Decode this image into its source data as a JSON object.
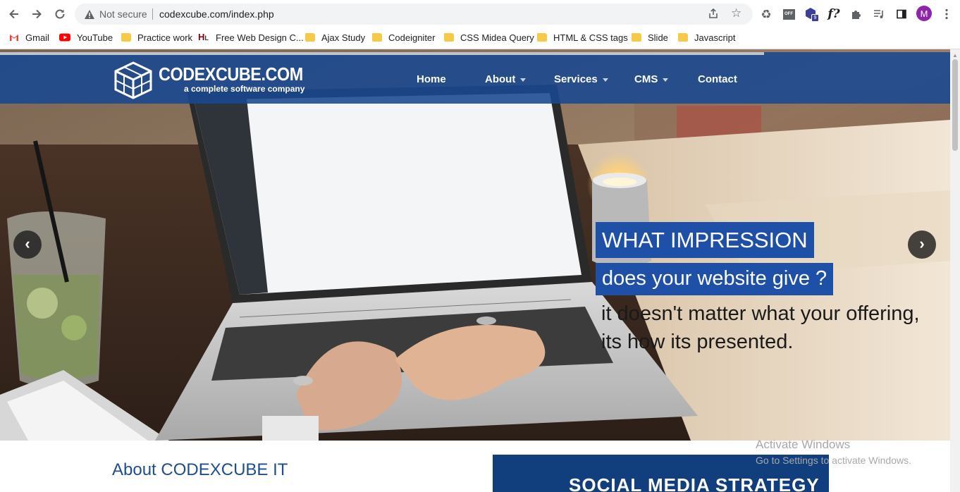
{
  "browser": {
    "security_status": "Not secure",
    "url": "codexcube.com/index.php",
    "profile_initial": "M",
    "extension_badge": "9",
    "extension_fx": "f?",
    "extension_off": "OFF"
  },
  "bookmarks": [
    {
      "label": "Gmail",
      "icon": "gmail-icon"
    },
    {
      "label": "YouTube",
      "icon": "youtube-icon"
    },
    {
      "label": "Practice work",
      "icon": "folder-icon"
    },
    {
      "label": "Free Web Design C...",
      "icon": "site-icon"
    },
    {
      "label": "Ajax Study",
      "icon": "folder-icon"
    },
    {
      "label": "Codeigniter",
      "icon": "folder-icon"
    },
    {
      "label": "CSS Midea Query",
      "icon": "folder-icon"
    },
    {
      "label": "HTML & CSS tags",
      "icon": "folder-icon"
    },
    {
      "label": "Slide",
      "icon": "folder-icon"
    },
    {
      "label": "Javascript",
      "icon": "folder-icon"
    }
  ],
  "site": {
    "brand": "CODEXCUBE.COM",
    "tagline": "a complete software company",
    "nav": [
      {
        "label": "Home",
        "dropdown": false
      },
      {
        "label": "About",
        "dropdown": true
      },
      {
        "label": "Services",
        "dropdown": true
      },
      {
        "label": "CMS",
        "dropdown": true
      },
      {
        "label": "Contact",
        "dropdown": false
      }
    ]
  },
  "hero": {
    "headline_1": "WHAT IMPRESSION",
    "headline_2": "does your website give ?",
    "caption_1": "it doesn't matter what your offering,",
    "caption_2": "its how its presented.",
    "prev_icon": "‹",
    "next_icon": "›",
    "accent": "#1f50a8"
  },
  "about_title": "About CODEXCUBE IT",
  "social_banner": "SOCIAL MEDIA STRATEGY",
  "watermark": {
    "line1": "Activate Windows",
    "line2": "Go to Settings to activate Windows."
  },
  "colors": {
    "navbar": "#184891",
    "headline_bg": "#1f50a8",
    "about_text": "#1f4e8c",
    "social_bg": "#113f7e"
  }
}
